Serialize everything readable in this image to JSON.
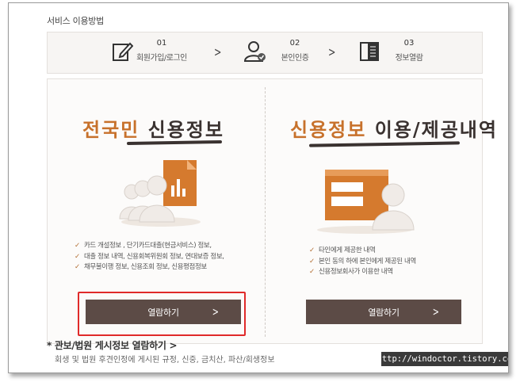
{
  "section_title": "서비스 이용방법",
  "steps": [
    {
      "num": "01",
      "label": "회원가입/로그인",
      "icon": "edit-document-icon"
    },
    {
      "num": "02",
      "label": "본인인증",
      "icon": "user-check-icon"
    },
    {
      "num": "03",
      "label": "정보열람",
      "icon": "book-icon"
    }
  ],
  "left_panel": {
    "title_accent": "전국민",
    "title_dark": "신용정보",
    "bullets": [
      "카드 개설정보 , 단기카드대출(현금서비스) 정보,",
      "대출 정보 내역, 신용회복위원회 정보, 연대보증 정보,",
      "채무불이행 정보, 신용조회 정보, 신용평점정보"
    ],
    "button_label": "열람하기"
  },
  "right_panel": {
    "title_accent": "신용정보",
    "title_dark": "이용/제공내역",
    "bullets": [
      "타인에게 제공한 내역",
      "본인 동의 하에 본인에게 제공된 내역",
      "신용정보회사가 이용한 내역"
    ],
    "button_label": "열람하기"
  },
  "bottom_link": "* 관보/법원 게시정보 열람하기 >",
  "bottom_sub": "회생 및 법원 후견인정에 게시된 규정, 신중, 금치산, 파산/회생정보",
  "watermark": "http://windoctor.tistory.com",
  "colors": {
    "accent": "#c7712b",
    "button": "#5c4b46",
    "highlight": "#e02a2a"
  }
}
